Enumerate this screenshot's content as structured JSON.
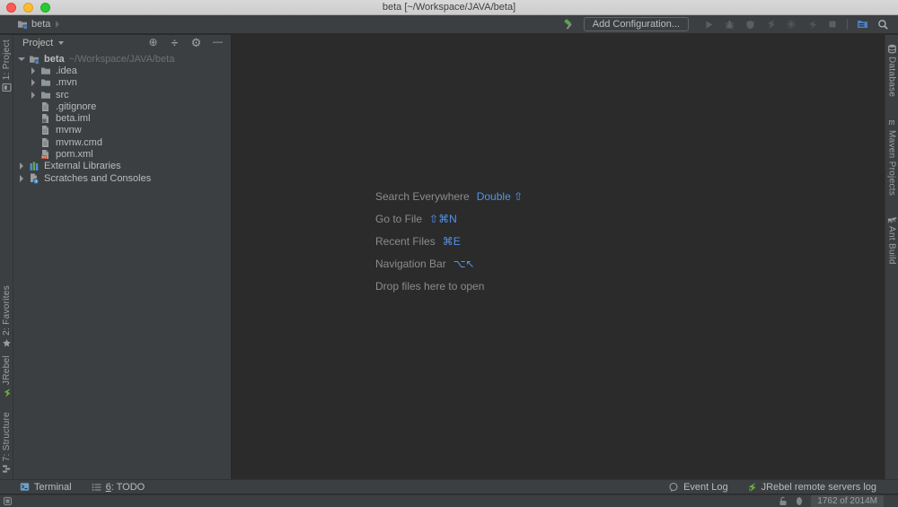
{
  "titlebar": {
    "title": "beta [~/Workspace/JAVA/beta]"
  },
  "toolbar": {
    "breadcrumb": "beta",
    "add_configuration": "Add Configuration..."
  },
  "project_panel": {
    "header_title": "Project",
    "tree": {
      "root_name": "beta",
      "root_path": "~/Workspace/JAVA/beta",
      "items": [
        {
          "label": ".idea",
          "kind": "folder"
        },
        {
          "label": ".mvn",
          "kind": "folder"
        },
        {
          "label": "src",
          "kind": "folder"
        },
        {
          "label": ".gitignore",
          "kind": "file"
        },
        {
          "label": "beta.iml",
          "kind": "module-file"
        },
        {
          "label": "mvnw",
          "kind": "file"
        },
        {
          "label": "mvnw.cmd",
          "kind": "file"
        },
        {
          "label": "pom.xml",
          "kind": "maven-file"
        }
      ],
      "external_libraries": "External Libraries",
      "scratches": "Scratches and Consoles"
    }
  },
  "editor": {
    "shortcuts": [
      {
        "label": "Search Everywhere",
        "keys": "Double ⇧"
      },
      {
        "label": "Go to File",
        "keys": "⇧⌘N"
      },
      {
        "label": "Recent Files",
        "keys": "⌘E"
      },
      {
        "label": "Navigation Bar",
        "keys": "⌥↖"
      }
    ],
    "drop_hint": "Drop files here to open"
  },
  "stripes": {
    "left_top": {
      "label": "1: Project"
    },
    "left_bottom": [
      {
        "label": "2: Favorites"
      },
      {
        "label": "JRebel"
      },
      {
        "label": "7: Structure"
      }
    ],
    "right": [
      {
        "label": "Database"
      },
      {
        "label": "Maven Projects"
      },
      {
        "label": "Ant Build"
      }
    ]
  },
  "bottom_bar": {
    "terminal": "Terminal",
    "todo_mnemonic": "6",
    "todo_rest": ": TODO",
    "event_log": "Event Log",
    "jrebel_log": "JRebel remote servers log"
  },
  "statusbar": {
    "memory": "1762 of 2014M"
  },
  "colors": {
    "accent_blue": "#5394ec",
    "panel_bg": "#3c3f41",
    "editor_bg": "#2b2b2b",
    "hammer_green": "#5fa348",
    "jrebel_green": "#6cb33e",
    "maven_badge": "#c4543a"
  }
}
